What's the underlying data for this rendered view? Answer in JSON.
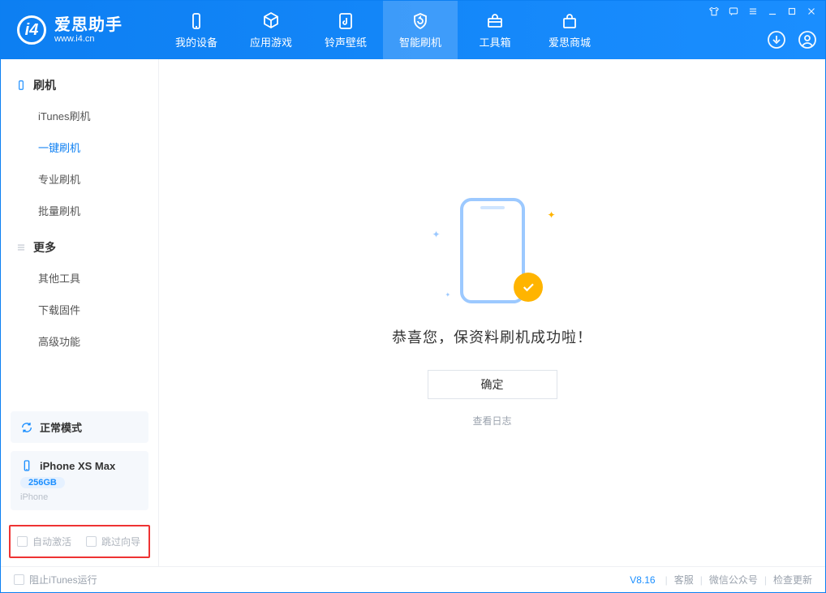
{
  "app": {
    "title": "爱思助手",
    "url": "www.i4.cn"
  },
  "nav": {
    "items": [
      {
        "label": "我的设备"
      },
      {
        "label": "应用游戏"
      },
      {
        "label": "铃声壁纸"
      },
      {
        "label": "智能刷机"
      },
      {
        "label": "工具箱"
      },
      {
        "label": "爱思商城"
      }
    ]
  },
  "sidebar": {
    "g1": {
      "title": "刷机",
      "items": [
        "iTunes刷机",
        "一键刷机",
        "专业刷机",
        "批量刷机"
      ]
    },
    "g2": {
      "title": "更多",
      "items": [
        "其他工具",
        "下载固件",
        "高级功能"
      ]
    },
    "mode": {
      "label": "正常模式"
    },
    "device": {
      "name": "iPhone XS Max",
      "storage": "256GB",
      "type": "iPhone"
    },
    "options": {
      "auto_activate": "自动激活",
      "skip_guide": "跳过向导"
    }
  },
  "main": {
    "message": "恭喜您，保资料刷机成功啦！",
    "ok": "确定",
    "view_log": "查看日志"
  },
  "status": {
    "block_itunes": "阻止iTunes运行",
    "version": "V8.16",
    "links": [
      "客服",
      "微信公众号",
      "检查更新"
    ]
  }
}
